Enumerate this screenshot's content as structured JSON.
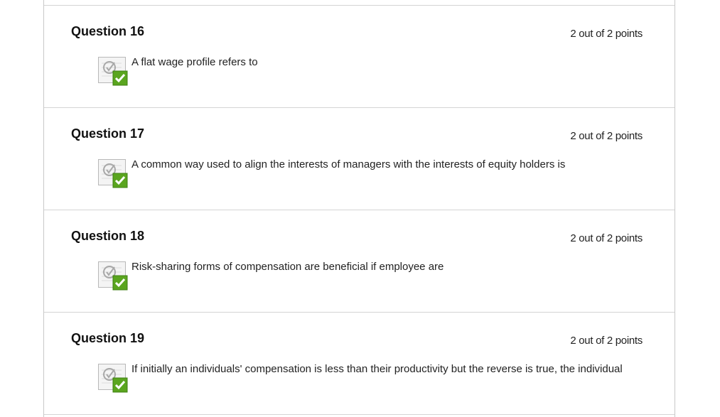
{
  "questions": [
    {
      "title": "Question 16",
      "points": "2 out of 2 points",
      "text": "A flat wage profile refers to",
      "status_icon": "correct-check-icon"
    },
    {
      "title": "Question 17",
      "points": "2 out of 2 points",
      "text": "A common way used to align the interests of managers with the interests of equity holders is",
      "status_icon": "correct-check-icon"
    },
    {
      "title": "Question 18",
      "points": "2 out of 2 points",
      "text": "Risk-sharing forms of compensation are beneficial if employee are",
      "status_icon": "correct-check-icon"
    },
    {
      "title": "Question 19",
      "points": "2 out of 2 points",
      "text": "If initially an individuals' compensation is less than their productivity but the reverse is true, the individual",
      "status_icon": "correct-check-icon"
    }
  ],
  "colors": {
    "check_green": "#5aa51f",
    "border": "#d4d4d4"
  }
}
